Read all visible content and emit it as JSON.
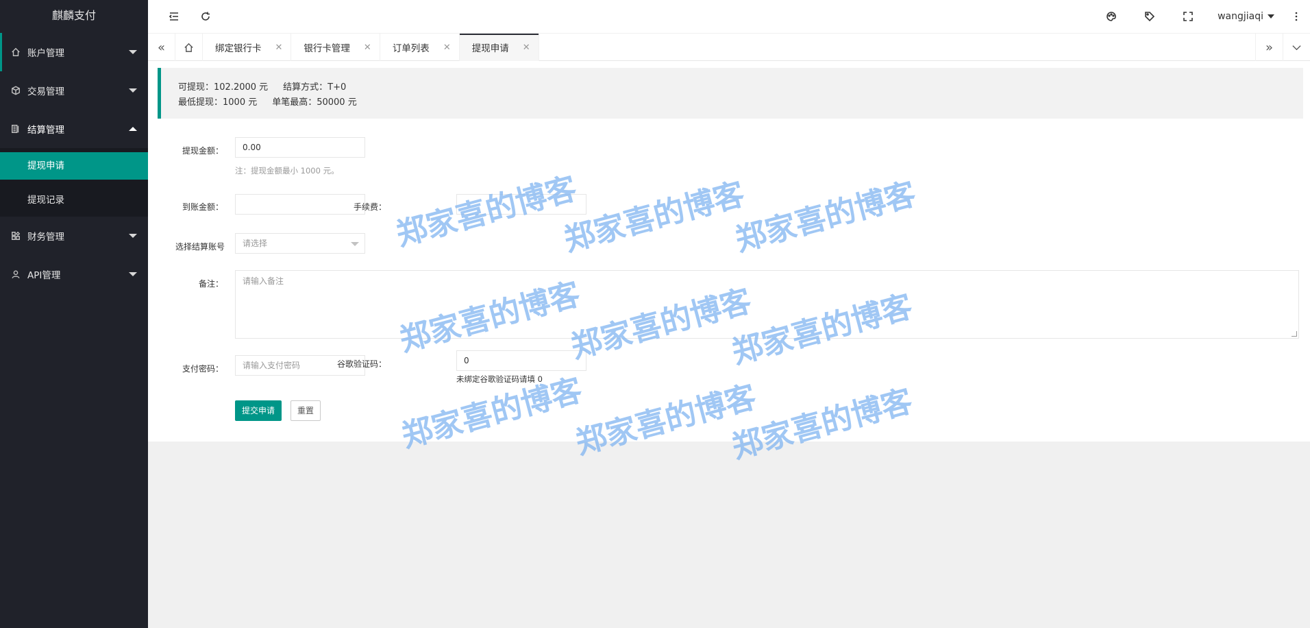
{
  "app": {
    "title": "麒麟支付"
  },
  "sidebar": {
    "items": [
      {
        "label": "账户管理",
        "icon": "home-icon"
      },
      {
        "label": "交易管理",
        "icon": "cube-icon"
      },
      {
        "label": "结算管理",
        "icon": "doc-icon",
        "submenu": [
          {
            "label": "提现申请"
          },
          {
            "label": "提现记录"
          }
        ]
      },
      {
        "label": "财务管理",
        "icon": "apps-icon"
      },
      {
        "label": "API管理",
        "icon": "user-icon"
      }
    ]
  },
  "header": {
    "username": "wangjiaqi"
  },
  "tabs": [
    {
      "label": "绑定银行卡"
    },
    {
      "label": "银行卡管理"
    },
    {
      "label": "订单列表"
    },
    {
      "label": "提现申请"
    }
  ],
  "notice": {
    "line1a": "可提现：102.2000 元",
    "line1b": "结算方式：T+0",
    "line2a": "最低提现：1000 元",
    "line2b": "单笔最高：50000 元"
  },
  "form": {
    "amount_label": "提现金额：",
    "amount_value": "0.00",
    "amount_hint": "注：提现金额最小 1000 元。",
    "received_label": "到账金额：",
    "received_value": "",
    "fee_label": "手续费：",
    "fee_value": "",
    "account_label": "选择结算账号",
    "account_placeholder": "请选择",
    "remark_label": "备注：",
    "remark_placeholder": "请输入备注",
    "paypwd_label": "支付密码：",
    "paypwd_placeholder": "请输入支付密码",
    "google_label": "谷歌验证码：",
    "google_value": "0",
    "google_hint": "未绑定谷歌验证码请填 0",
    "submit_label": "提交申请",
    "reset_label": "重置"
  },
  "watermark": {
    "text": "郑家喜的博客"
  },
  "colors": {
    "accent": "#009688",
    "sidebar_bg": "#20222a",
    "submenu_bg": "#181a20"
  }
}
